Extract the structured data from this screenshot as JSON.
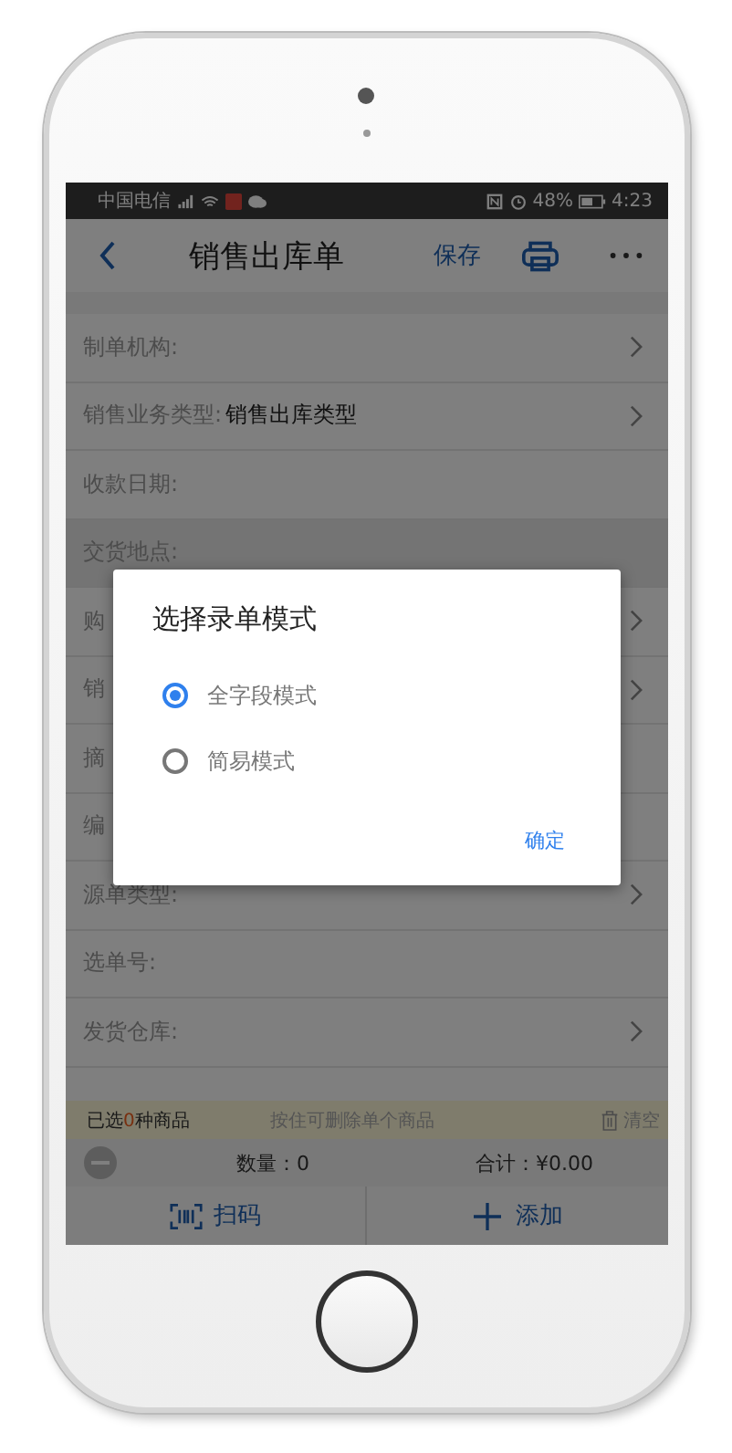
{
  "status_bar": {
    "carrier": "中国电信",
    "battery": "48%",
    "time": "4:23"
  },
  "nav": {
    "title": "销售出库单",
    "save": "保存"
  },
  "form_rows": [
    {
      "kind": "field",
      "label": "制单机构:",
      "has_chevron": true
    },
    {
      "kind": "field",
      "label": "销售业务类型:",
      "value": "销售出库类型",
      "has_chevron": true
    },
    {
      "kind": "field",
      "label": "收款日期:",
      "has_chevron": false
    },
    {
      "kind": "header",
      "label": "交货地点:",
      "has_chevron": false
    },
    {
      "kind": "field",
      "label": "购",
      "has_chevron": true
    },
    {
      "kind": "field",
      "label": "销",
      "has_chevron": true
    },
    {
      "kind": "field",
      "label": "摘",
      "has_chevron": false
    },
    {
      "kind": "field",
      "label": "编",
      "has_chevron": false
    },
    {
      "kind": "field",
      "label": "源单类型:",
      "has_chevron": true
    },
    {
      "kind": "field",
      "label": "选单号:",
      "has_chevron": false
    },
    {
      "kind": "field",
      "label": "发货仓库:",
      "has_chevron": true
    }
  ],
  "selection_bar": {
    "prefix": "已选",
    "count": "0",
    "suffix": "种商品",
    "hint": "按住可删除单个商品",
    "clear": "清空"
  },
  "summary": {
    "quantity": "数量：0",
    "total": "合计：¥0.00"
  },
  "actions": {
    "scan": "扫码",
    "add": "添加"
  },
  "dialog": {
    "title": "选择录单模式",
    "options": [
      {
        "label": "全字段模式",
        "selected": true
      },
      {
        "label": "简易模式",
        "selected": false
      }
    ],
    "confirm": "确定"
  }
}
